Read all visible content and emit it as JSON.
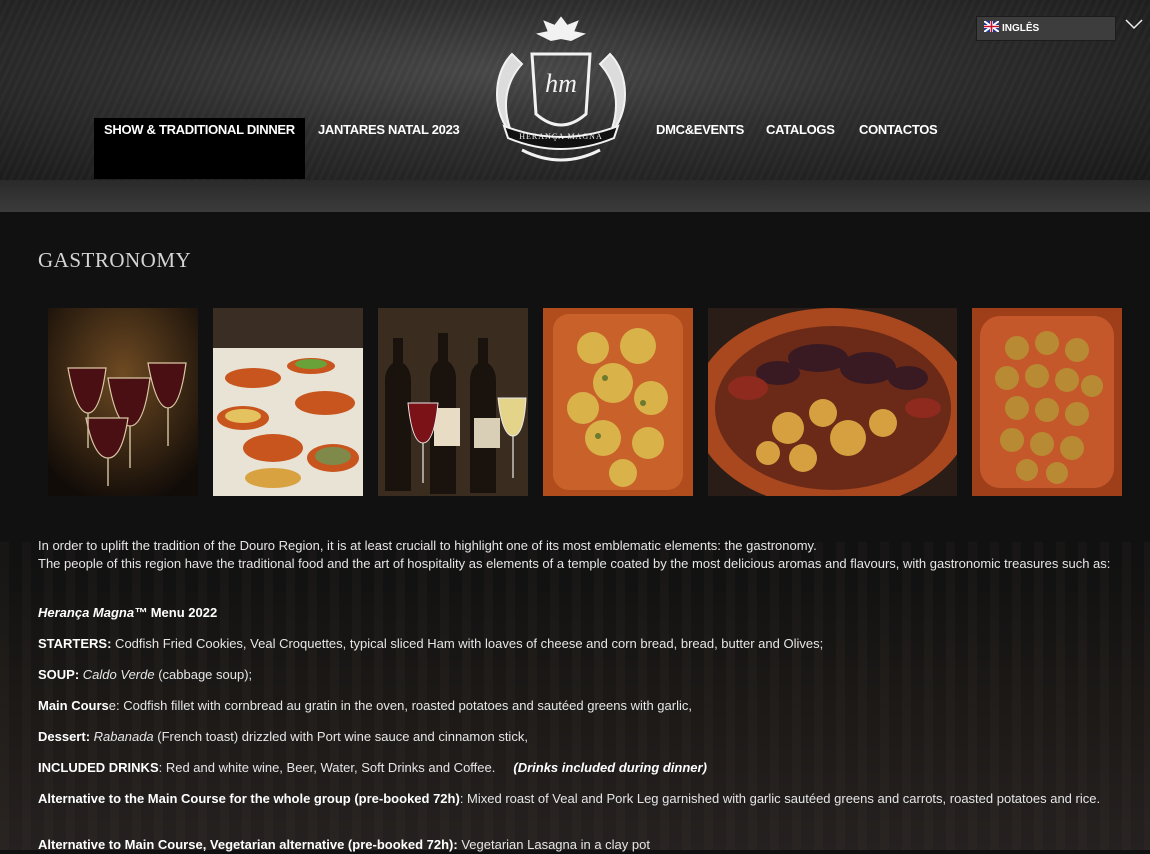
{
  "header": {
    "nav": [
      {
        "label": "SHOW & TRADITIONAL DINNER",
        "active": true
      },
      {
        "label": "JANTARES NATAL 2023"
      },
      {
        "label": "DMC&EVENTS"
      },
      {
        "label": "CATALOGS"
      },
      {
        "label": "CONTACTOS"
      }
    ],
    "logo": {
      "monogram": "hm",
      "name": "HERANÇA MAGNA"
    },
    "language": {
      "label": "INGLÊS",
      "flag_icon": "uk-flag-icon",
      "arrow_icon": "chevron-down-icon"
    }
  },
  "page": {
    "title": "GASTRONOMY",
    "gallery": [
      {
        "icon": "wine-glasses-photo"
      },
      {
        "icon": "buffet-table-photo"
      },
      {
        "icon": "wine-bottles-photo"
      },
      {
        "icon": "codfish-dish-photo"
      },
      {
        "icon": "sausage-platter-photo"
      },
      {
        "icon": "croquettes-photo"
      }
    ],
    "intro": "In order to uplift the tradition of the Douro Region, it is at least cruciall to highlight one of its most emblematic elements: the gastronomy.",
    "intro2": "The people of this region have the traditional food and the art of hospitality as elements of a temple coated by the most delicious aromas and flavours, with gastronomic treasures such as:",
    "menu_title_brand": "Herança Magna™",
    "menu_title_rest": " Menu 2022",
    "starters_label": "STARTERS:",
    "starters_text": " Codfish Fried Cookies, Veal Croquettes, typical sliced Ham with loaves of cheese and corn bread, bread, butter and Olives;",
    "soup_label": "SOUP:",
    "soup_name": "Caldo Verde",
    "soup_text": " (cabbage soup);",
    "main_label": "Main Cours",
    "main_text": "e: Codfish fillet with cornbread au gratin in the oven, roasted potatoes and sautéed greens with garlic,",
    "dessert_label": "Dessert:",
    "dessert_name": "Rabanada",
    "dessert_text": " (French toast) drizzled with Port wine sauce and cinnamon stick,",
    "drinks_label": "INCLUDED DRINKS",
    "drinks_text": ": Red and white wine, Beer, Water, Soft Drinks and Coffee.",
    "drinks_note": "(Drinks included during dinner)",
    "alt_label": "Alternative to the Main Course for the whole group (pre-booked 72h)",
    "alt_text": ": Mixed roast of Veal and Pork Leg garnished with garlic sautéed greens and carrots, roasted potatoes and rice.",
    "veg_label": "Alternative to Main Course, Vegetarian alternative (pre-booked 72h):",
    "veg_text": " Vegetarian Lasagna in a clay pot"
  }
}
